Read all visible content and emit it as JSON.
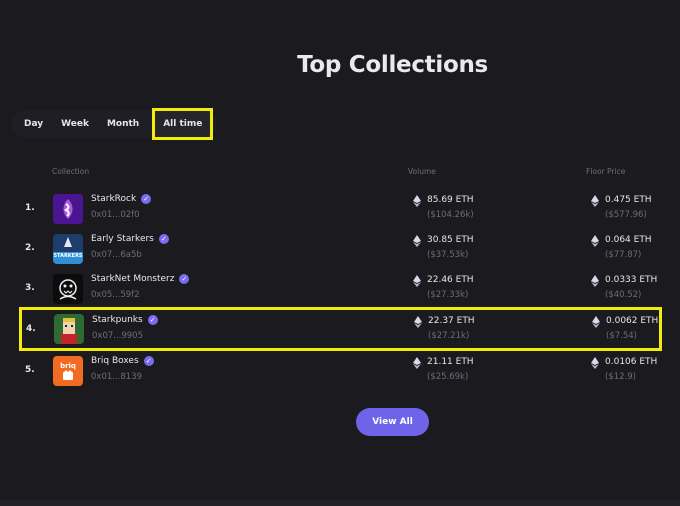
{
  "header": {
    "title": "Top Collections"
  },
  "period_tabs": [
    {
      "label": "Day",
      "active": false
    },
    {
      "label": "Week",
      "active": false
    },
    {
      "label": "Month",
      "active": false
    },
    {
      "label": "All time",
      "active": true
    }
  ],
  "table": {
    "columns": {
      "collection": "Collection",
      "volume": "Volume",
      "floor": "Floor Price"
    },
    "rows": [
      {
        "rank": "1.",
        "name": "StarkRock",
        "address": "0x01...02f0",
        "volume_eth": "85.69 ETH",
        "volume_usd": "($104.26k)",
        "floor_eth": "0.475 ETH",
        "floor_usd": "($577.96)",
        "highlighted": false
      },
      {
        "rank": "2.",
        "name": "Early Starkers",
        "address": "0x07...6a5b",
        "volume_eth": "30.85 ETH",
        "volume_usd": "($37.53k)",
        "floor_eth": "0.064 ETH",
        "floor_usd": "($77.87)",
        "highlighted": false
      },
      {
        "rank": "3.",
        "name": "StarkNet Monsterz",
        "address": "0x05...59f2",
        "volume_eth": "22.46 ETH",
        "volume_usd": "($27.33k)",
        "floor_eth": "0.0333 ETH",
        "floor_usd": "($40.52)",
        "highlighted": false
      },
      {
        "rank": "4.",
        "name": "Starkpunks",
        "address": "0x07...9905",
        "volume_eth": "22.37 ETH",
        "volume_usd": "($27.21k)",
        "floor_eth": "0.0062 ETH",
        "floor_usd": "($7.54)",
        "highlighted": true
      },
      {
        "rank": "5.",
        "name": "Briq Boxes",
        "address": "0x01...8139",
        "volume_eth": "21.11 ETH",
        "volume_usd": "($25.69k)",
        "floor_eth": "0.0106 ETH",
        "floor_usd": "($12.9)",
        "highlighted": false
      }
    ]
  },
  "avatars": {
    "early_starkers_text": "STARKERS",
    "briq_text": "briq"
  },
  "view_all_label": "View All",
  "colors": {
    "background": "#1b1a1f",
    "accent": "#6f63ea",
    "highlight": "#f2ec0a",
    "verified": "#7a6cf0"
  }
}
